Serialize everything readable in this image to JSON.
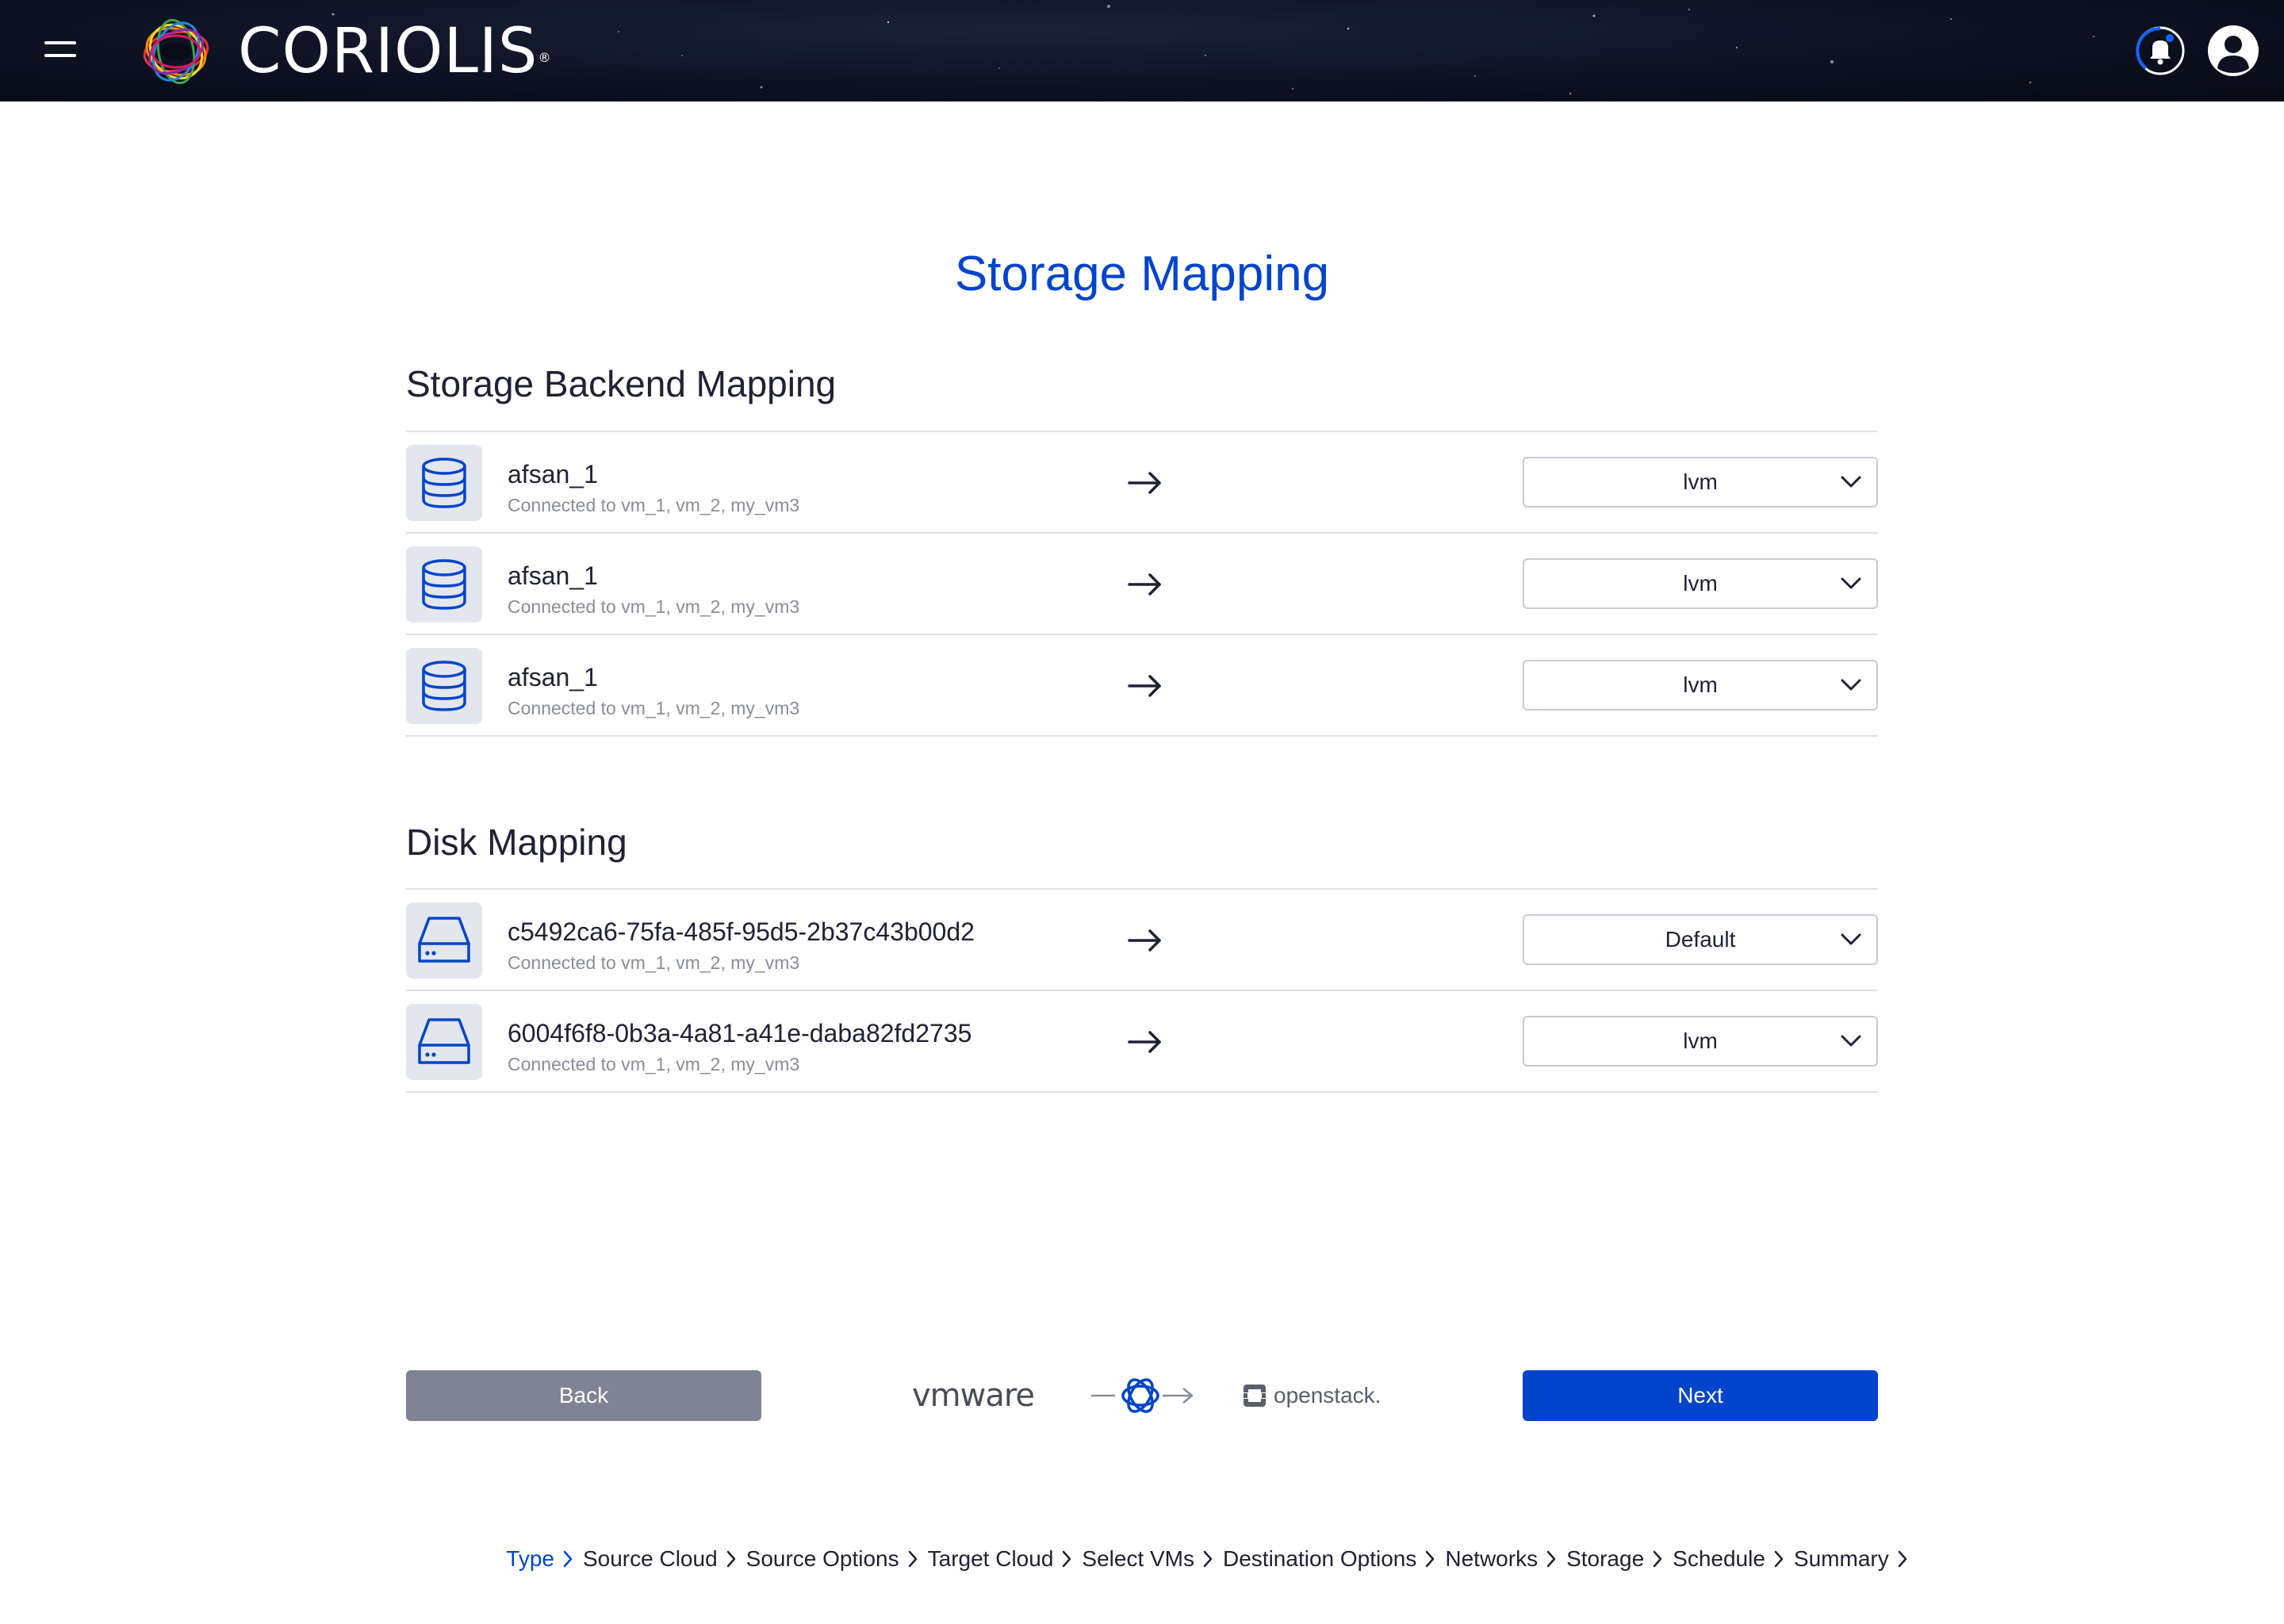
{
  "header": {
    "app_name": "CORIOLIS",
    "trademark": "®",
    "menu_icon": "hamburger-menu-icon",
    "notifications_icon": "bell-icon",
    "user_icon": "user-avatar-icon"
  },
  "page": {
    "title": "Storage Mapping"
  },
  "backend_section": {
    "title": "Storage Backend Mapping",
    "rows": [
      {
        "name": "afsan_1",
        "connected": "Connected to vm_1, vm_2, my_vm3",
        "target": "lvm",
        "icon": "database-icon"
      },
      {
        "name": "afsan_1",
        "connected": "Connected to vm_1, vm_2, my_vm3",
        "target": "lvm",
        "icon": "database-icon"
      },
      {
        "name": "afsan_1",
        "connected": "Connected to vm_1, vm_2, my_vm3",
        "target": "lvm",
        "icon": "database-icon"
      }
    ]
  },
  "disk_section": {
    "title": "Disk Mapping",
    "rows": [
      {
        "name": "c5492ca6-75fa-485f-95d5-2b37c43b00d2",
        "connected": "Connected to vm_1, vm_2, my_vm3",
        "target": "Default",
        "icon": "disk-drive-icon"
      },
      {
        "name": "6004f6f8-0b3a-4a81-a41e-daba82fd2735",
        "connected": "Connected to vm_1, vm_2, my_vm3",
        "target": "lvm",
        "icon": "disk-drive-icon"
      }
    ]
  },
  "footer": {
    "back_label": "Back",
    "next_label": "Next",
    "source_logo": "vmware",
    "target_logo": "openstack."
  },
  "breadcrumb": {
    "items": [
      "Type",
      "Source Cloud",
      "Source Options",
      "Target Cloud",
      "Select VMs",
      "Destination Options",
      "Networks",
      "Storage",
      "Schedule",
      "Summary"
    ],
    "active_index": 0
  },
  "colors": {
    "accent": "#0044cb",
    "back_button": "#7f8495",
    "icon_bg": "#e3e6ed",
    "divider": "#dfe1e6",
    "muted_text": "#8a8c99"
  }
}
